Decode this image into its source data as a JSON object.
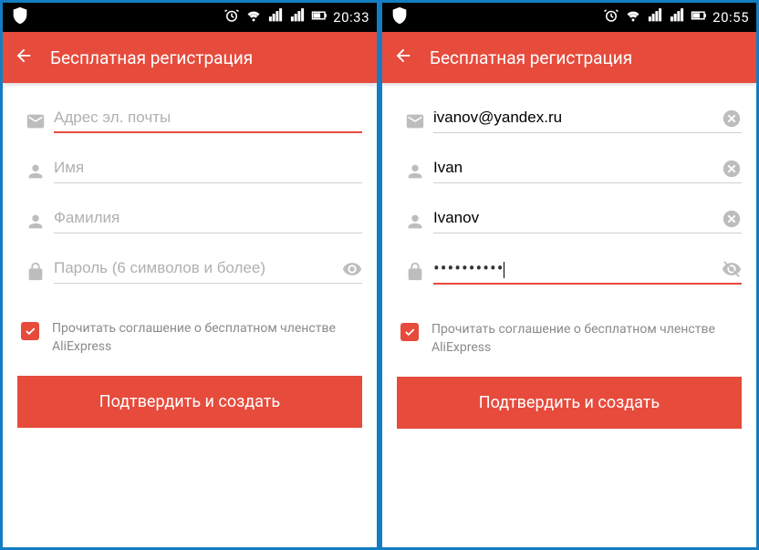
{
  "screens": [
    {
      "status": {
        "time": "20:33"
      },
      "appbar": {
        "title": "Бесплатная регистрация"
      },
      "fields": {
        "email": {
          "placeholder": "Адрес эл. почты",
          "value": "",
          "active": true,
          "clear": false,
          "trail": null
        },
        "first": {
          "placeholder": "Имя",
          "value": "",
          "active": false,
          "clear": false,
          "trail": null
        },
        "last": {
          "placeholder": "Фамилия",
          "value": "",
          "active": false,
          "clear": false,
          "trail": null
        },
        "password": {
          "placeholder": "Пароль (6 символов и более)",
          "value": "",
          "active": false,
          "clear": false,
          "trail": "eye"
        }
      },
      "agreement": {
        "text": "Прочитать соглашение о бесплатном членстве AliExpress",
        "checked": true
      },
      "submit": "Подтвердить и создать"
    },
    {
      "status": {
        "time": "20:55"
      },
      "appbar": {
        "title": "Бесплатная регистрация"
      },
      "fields": {
        "email": {
          "placeholder": "",
          "value": "ivanov@yandex.ru",
          "active": false,
          "clear": true,
          "trail": null
        },
        "first": {
          "placeholder": "",
          "value": "Ivan",
          "active": false,
          "clear": true,
          "trail": null
        },
        "last": {
          "placeholder": "",
          "value": "Ivanov",
          "active": false,
          "clear": true,
          "trail": null
        },
        "password": {
          "placeholder": "",
          "value": "••••••••••",
          "active": true,
          "clear": false,
          "trail": "eye-off"
        }
      },
      "agreement": {
        "text": "Прочитать соглашение о бесплатном членстве AliExpress",
        "checked": true
      },
      "submit": "Подтвердить и создать"
    }
  ]
}
